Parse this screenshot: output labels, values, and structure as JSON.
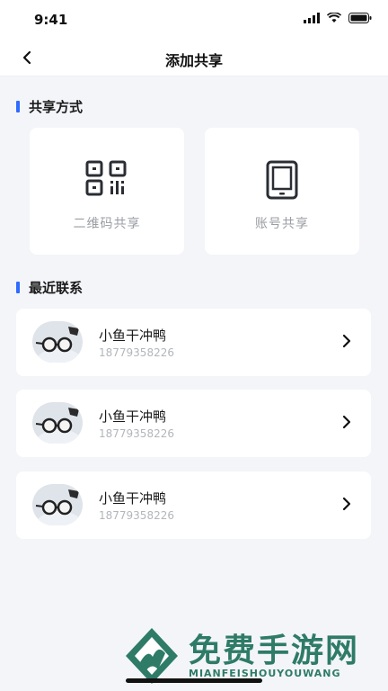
{
  "status_bar": {
    "time": "9:41"
  },
  "nav": {
    "title": "添加共享"
  },
  "share_section": {
    "title": "共享方式",
    "options": [
      {
        "label": "二维码共享",
        "icon": "qr-code-icon"
      },
      {
        "label": "账号共享",
        "icon": "tablet-icon"
      }
    ]
  },
  "recent_section": {
    "title": "最近联系",
    "contacts": [
      {
        "name": "小鱼干冲鸭",
        "phone": "18779358226"
      },
      {
        "name": "小鱼干冲鸭",
        "phone": "18779358226"
      },
      {
        "name": "小鱼干冲鸭",
        "phone": "18779358226"
      }
    ]
  },
  "watermark": {
    "title": "免费手游网",
    "subtitle": "MIANFEISHOUYOUWANG"
  },
  "colors": {
    "accent": "#2f6bff",
    "background": "#f3f5f9",
    "watermark": "#2e7b67"
  }
}
